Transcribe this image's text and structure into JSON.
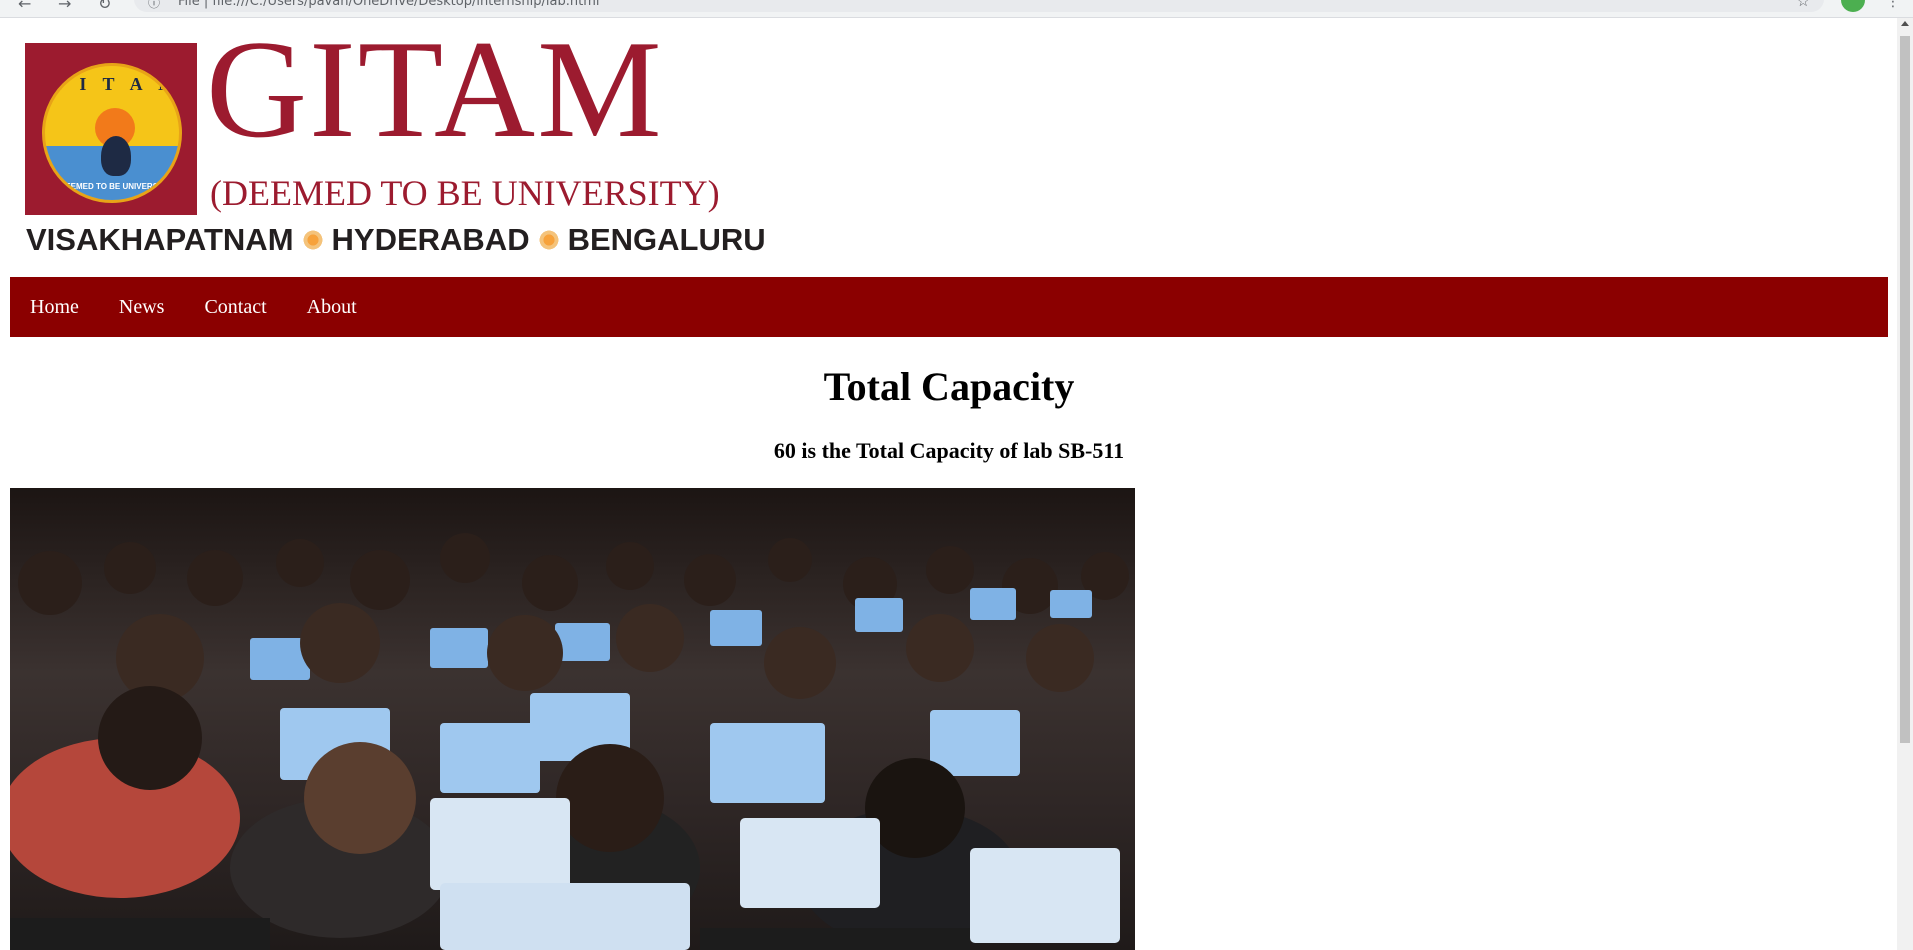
{
  "browser": {
    "back_icon": "arrow-left-icon",
    "forward_icon": "arrow-right-icon",
    "reload_icon": "reload-icon",
    "info_icon": "info-icon",
    "url_text": "File  |  file:///C:/Users/pavan/OneDrive/Desktop/internship/lab.html",
    "star_icon": "star-icon",
    "menu_icon": "more-vert-icon"
  },
  "logo": {
    "seal_text": "G I T A M",
    "seal_bottom_text": "DEEMED TO BE UNIVERSITY",
    "name": "GITAM",
    "subtitle": "(DEEMED TO BE UNIVERSITY)",
    "cities": [
      "VISAKHAPATNAM",
      "HYDERABAD",
      "BENGALURU"
    ],
    "brand_color": "#9c1b2f"
  },
  "nav": {
    "background": "#8b0000",
    "items": [
      {
        "label": "Home"
      },
      {
        "label": "News"
      },
      {
        "label": "Contact"
      },
      {
        "label": "About"
      }
    ]
  },
  "main": {
    "title": "Total Capacity",
    "subtitle": "60 is the Total Capacity of lab SB-511"
  },
  "photo": {
    "subject": "students-using-laptops-in-lecture-hall"
  }
}
